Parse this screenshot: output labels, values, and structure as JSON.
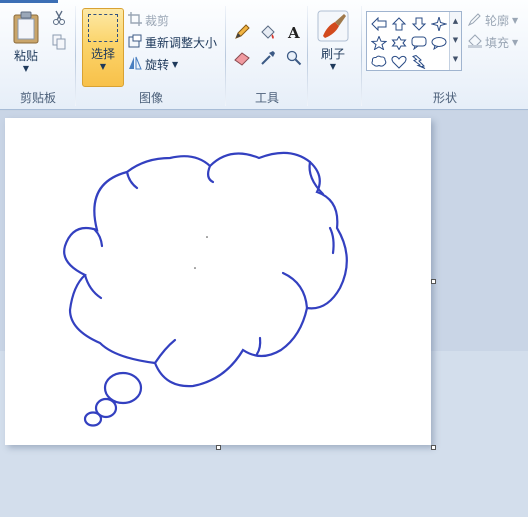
{
  "clipboard": {
    "paste_label": "粘贴",
    "group_label": "剪贴板"
  },
  "image": {
    "select_label": "选择",
    "crop_label": "裁剪",
    "resize_label": "重新调整大小",
    "rotate_label": "旋转",
    "group_label": "图像"
  },
  "tools": {
    "group_label": "工具"
  },
  "brushes": {
    "label": "刷子"
  },
  "shapes": {
    "outline_label": "轮廓",
    "fill_label": "填充",
    "group_label": "形状"
  },
  "colors": {
    "accent": "#3c6fb5",
    "drawing_stroke": "#3340c0",
    "selection_highlight": "#fbd46a"
  }
}
